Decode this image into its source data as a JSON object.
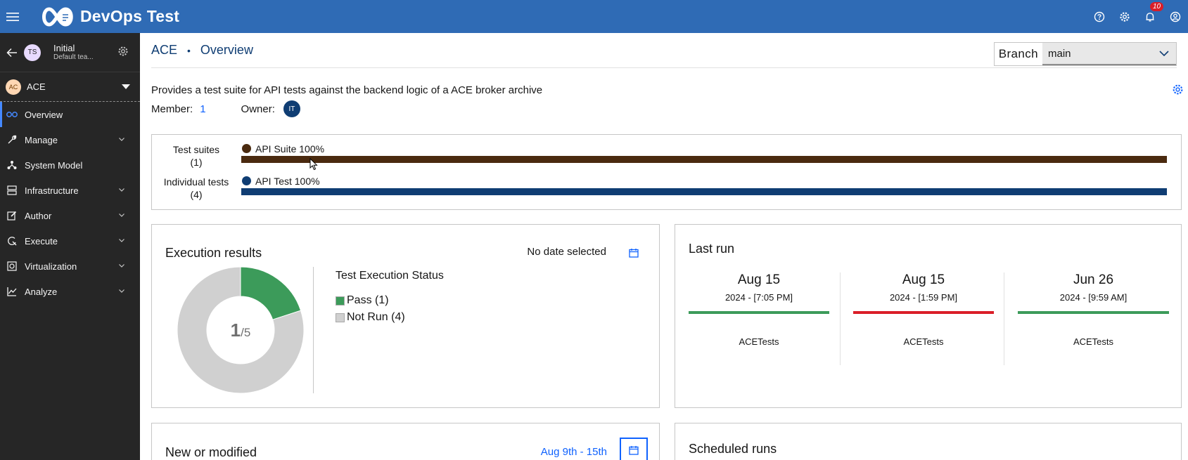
{
  "app": {
    "title": "DevOps Test",
    "notification_count": "10"
  },
  "sidebar": {
    "team": {
      "avatar": "TS",
      "name": "Initial",
      "subtitle": "Default tea..."
    },
    "project": {
      "avatar": "AC",
      "name": "ACE"
    },
    "items": [
      {
        "label": "Overview",
        "icon": "overview-icon",
        "active": true
      },
      {
        "label": "Manage",
        "icon": "wrench-icon"
      },
      {
        "label": "System Model",
        "icon": "model-icon"
      },
      {
        "label": "Infrastructure",
        "icon": "infrastructure-icon"
      },
      {
        "label": "Author",
        "icon": "edit-icon"
      },
      {
        "label": "Execute",
        "icon": "execute-icon"
      },
      {
        "label": "Virtualization",
        "icon": "virtualization-icon"
      },
      {
        "label": "Analyze",
        "icon": "analyze-icon"
      }
    ]
  },
  "header": {
    "project": "ACE",
    "separator": "•",
    "page": "Overview",
    "branch_label": "Branch",
    "branch_value": "main"
  },
  "description": "Provides a test suite for API tests against the backend logic of a ACE broker archive",
  "meta": {
    "member_label": "Member:",
    "member_count": "1",
    "owner_label": "Owner:",
    "owner_avatar": "IT"
  },
  "composition": {
    "suites": {
      "label_line1": "Test suites",
      "label_line2": "(1)",
      "legend": "API Suite 100%",
      "color": "#4a2a0f",
      "fraction": 1.0
    },
    "tests": {
      "label_line1": "Individual tests",
      "label_line2": "(4)",
      "legend": "API Test 100%",
      "color": "#0f3d73",
      "fraction": 1.0
    }
  },
  "execution": {
    "title": "Execution results",
    "date_text": "No date selected",
    "center_num": "1",
    "center_den": "/5",
    "status_title": "Test Execution Status",
    "legend": [
      {
        "label": "Pass (1)",
        "color": "#3c9b5a",
        "value": 1
      },
      {
        "label": "Not Run (4)",
        "color": "#d0d0d0",
        "value": 4
      }
    ]
  },
  "last_run": {
    "title": "Last run",
    "runs": [
      {
        "date": "Aug 15",
        "time": "2024 - [7:05 PM]",
        "name": "ACETests",
        "color": "#3c9b5a"
      },
      {
        "date": "Aug 15",
        "time": "2024 - [1:59 PM]",
        "name": "ACETests",
        "color": "#da1e28"
      },
      {
        "date": "Jun 26",
        "time": "2024 - [9:59 AM]",
        "name": "ACETests",
        "color": "#3c9b5a"
      }
    ]
  },
  "new_modified": {
    "title": "New or modified",
    "date_range": "Aug 9th - 15th"
  },
  "scheduled": {
    "title": "Scheduled runs"
  },
  "colors": {
    "topbar": "#2f6bb5",
    "sidebar": "#262626",
    "link": "#0f62fe",
    "breadcrumb": "#0f3d73"
  }
}
